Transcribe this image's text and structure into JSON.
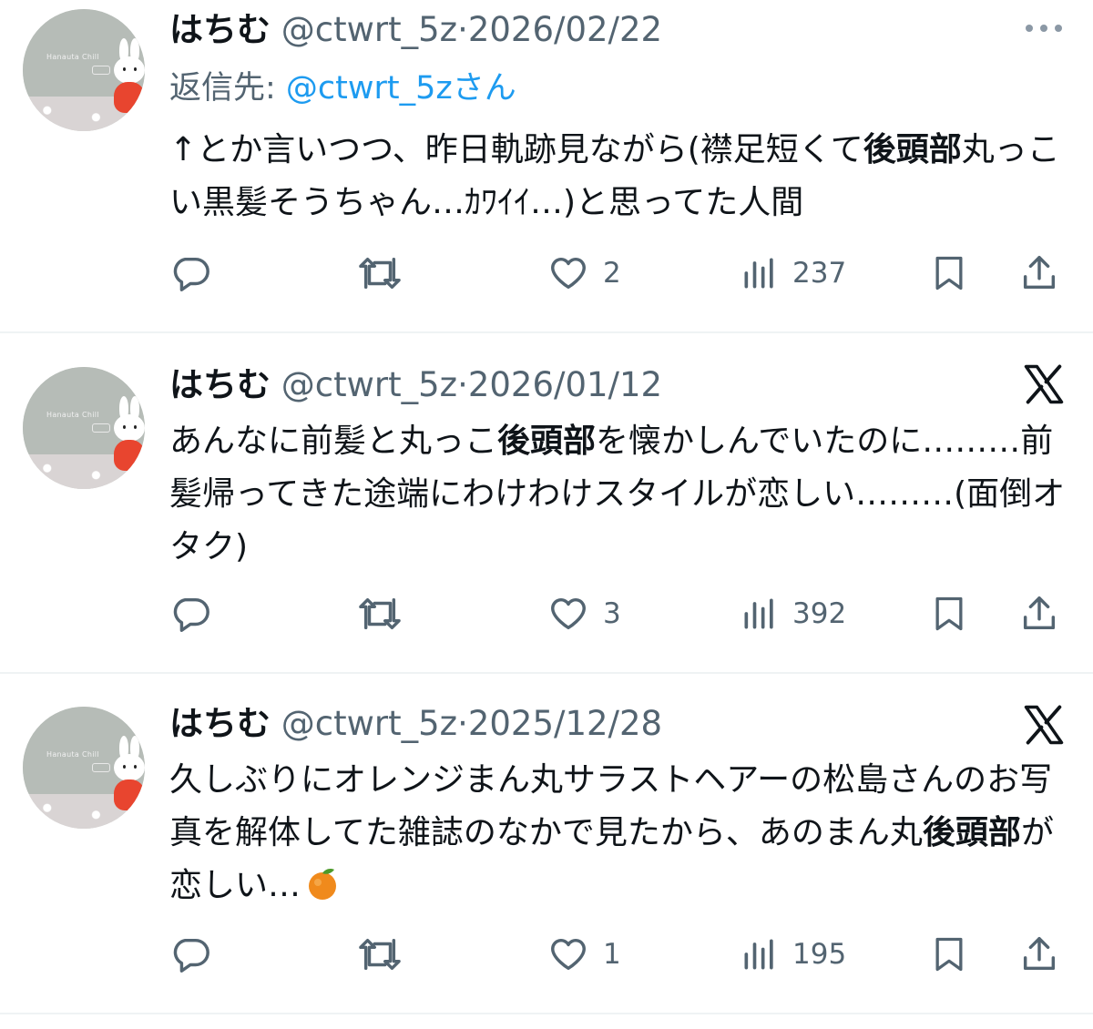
{
  "tweets": [
    {
      "name": "はちむ",
      "handle": "@ctwrt_5z",
      "separator": "·",
      "date": "2026/02/22",
      "reply_prefix": "返信先: ",
      "reply_mention": "@ctwrt_5z",
      "reply_suffix": "さん",
      "text_parts": [
        "↑とか言いつつ、昨日軌跡見ながら(襟足短くて",
        "後頭部",
        "丸っこい黒髪そうちゃん…ｶﾜｲｲ…)と思ってた人間"
      ],
      "likes": "2",
      "views": "237",
      "corner_icon": "more-icon"
    },
    {
      "name": "はちむ",
      "handle": "@ctwrt_5z",
      "separator": "·",
      "date": "2026/01/12",
      "text_parts": [
        "あんなに前髪と丸っこ",
        "後頭部",
        "を懐かしんでいたのに………前髪帰ってきた途端にわけわけスタイルが恋しい………(面倒オタク)"
      ],
      "likes": "3",
      "views": "392",
      "corner_icon": "x-logo-icon"
    },
    {
      "name": "はちむ",
      "handle": "@ctwrt_5z",
      "separator": "·",
      "date": "2025/12/28",
      "text_parts": [
        "久しぶりにオレンジまん丸サラストヘアーの松島さんのお写真を解体してた雑誌のなかで見たから、あのまん丸",
        "後頭部",
        "が恋しい…"
      ],
      "emoji": "tangerine",
      "likes": "1",
      "views": "195",
      "corner_icon": "x-logo-icon"
    }
  ],
  "avatar_sign_text": "Hanauta Chill",
  "colors": {
    "text": "#0f1419",
    "secondary": "#536471",
    "link": "#1d9bf0",
    "divider": "#eff3f4"
  }
}
